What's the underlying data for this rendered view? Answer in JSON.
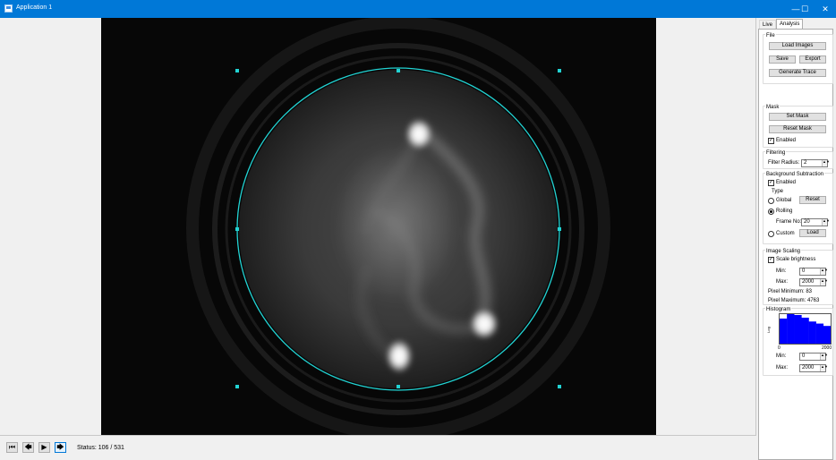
{
  "window": {
    "title": "Application 1",
    "min_glyph": "—",
    "max_glyph": "☐",
    "close_glyph": "✕"
  },
  "navigation": {
    "first_glyph": "⏮",
    "prev_glyph": "🡄",
    "play_glyph": "▶",
    "next_glyph": "🡆",
    "status_text": "Status: 106 / 531"
  },
  "tabs": [
    {
      "label": "Live",
      "active": false
    },
    {
      "label": "Analysis",
      "active": true
    }
  ],
  "file": {
    "group_label": "File",
    "load_images": "Load Images",
    "save": "Save",
    "export": "Export",
    "generate_trace": "Generate Trace"
  },
  "mask": {
    "group_label": "Mask",
    "set_mask": "Set Mask",
    "reset_mask": "Reset Mask",
    "enabled_label": "Enabled",
    "enabled_checked": true
  },
  "filtering": {
    "group_label": "Filtering",
    "radius_label": "Filter Radius:",
    "radius_value": "2"
  },
  "background": {
    "group_label": "Background Subtraction",
    "enabled_label": "Enabled",
    "enabled_checked": true,
    "type_label": "Type",
    "global_label": "Global",
    "reset_label": "Reset",
    "rolling_label": "Rolling",
    "frame_label": "Frame No:",
    "frame_value": "20",
    "custom_label": "Custom",
    "load_label": "Load",
    "selected": "Rolling"
  },
  "scaling": {
    "group_label": "Image Scaling",
    "scale_label": "Scale brightness",
    "scale_checked": true,
    "min_label": "Min:",
    "min_value": "0",
    "max_label": "Max:",
    "max_value": "2000",
    "pixel_min": "Pixel Minimum: 83",
    "pixel_max": "Pixel Maximum: 4763"
  },
  "histogram": {
    "group_label": "Histogram",
    "ylabel": "Log",
    "x_min": "0",
    "x_max": "2000",
    "min_label": "Min:",
    "min_value": "0",
    "max_label": "Max:",
    "max_value": "2000",
    "bars": [
      0.85,
      1.0,
      0.97,
      0.88,
      0.75,
      0.68,
      0.6
    ],
    "bar_color": "#0000ff"
  },
  "colors": {
    "titlebar": "#0078d7",
    "roi": "#22d3d3",
    "viewer_bg": "#050505"
  }
}
